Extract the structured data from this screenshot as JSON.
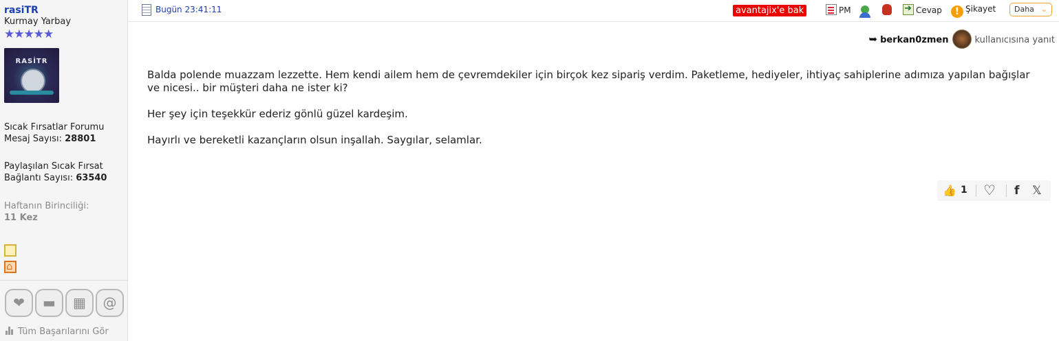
{
  "user": {
    "username": "rasiTR",
    "rank": "Kurmay Yarbay",
    "stars": "★★★★★",
    "avatar_text": "RASİTR",
    "stats": [
      {
        "line1": "Sıcak Fırsatlar Forumu",
        "line2_label": "Mesaj Sayısı:",
        "line2_value": "28801"
      },
      {
        "line1": "Paylaşılan Sıcak Fırsat",
        "line2_label": "Bağlantı Sayısı:",
        "line2_value": "63540"
      },
      {
        "line1": "Haftanın Birinciliği:",
        "line2_label": "",
        "line2_value": "11 Kez"
      }
    ],
    "all_badges_label": "Tüm Başarılarını Gör"
  },
  "post": {
    "date": "Bugün 23:41:11",
    "toolbar": {
      "advantage": "avantajix'e bak",
      "pm": "PM",
      "reply": "Cevap",
      "report": "Şikayet",
      "more": "Daha",
      "warn_glyph": "!"
    },
    "reply_to": {
      "username": "berkan0zmen",
      "suffix": "kullanıcısına yanıt"
    },
    "paragraphs": [
      "Balda polende muazzam lezzette. Hem kendi ailem hem de çevremdekiler için birçok kez sipariş verdim. Paketleme, hediyeler, ihtiyaç sahiplerine adımıza yapılan bağışlar ve nicesi.. bir müşteri daha ne ister ki?",
      "Her şey için teşekkür ederiz gönlü güzel kardeşim.",
      "Hayırlı ve bereketli kazançların olsun inşallah. Saygılar, selamlar."
    ],
    "actions": {
      "like_count": "1"
    }
  },
  "icons": {
    "thumbs_up": "👍",
    "heart": "♡",
    "facebook": "f",
    "x": "𝕏",
    "reply_arrow": "➥",
    "badge_heart": "❤",
    "badge_chat": "▬",
    "badge_calendar": "▦",
    "badge_at": "@",
    "chevron": "⌄"
  },
  "colors": {
    "username": "#1a3fb0",
    "stars": "#5a5ad8",
    "advantage_bg": "#ee0000",
    "more_border": "#f0a030"
  }
}
